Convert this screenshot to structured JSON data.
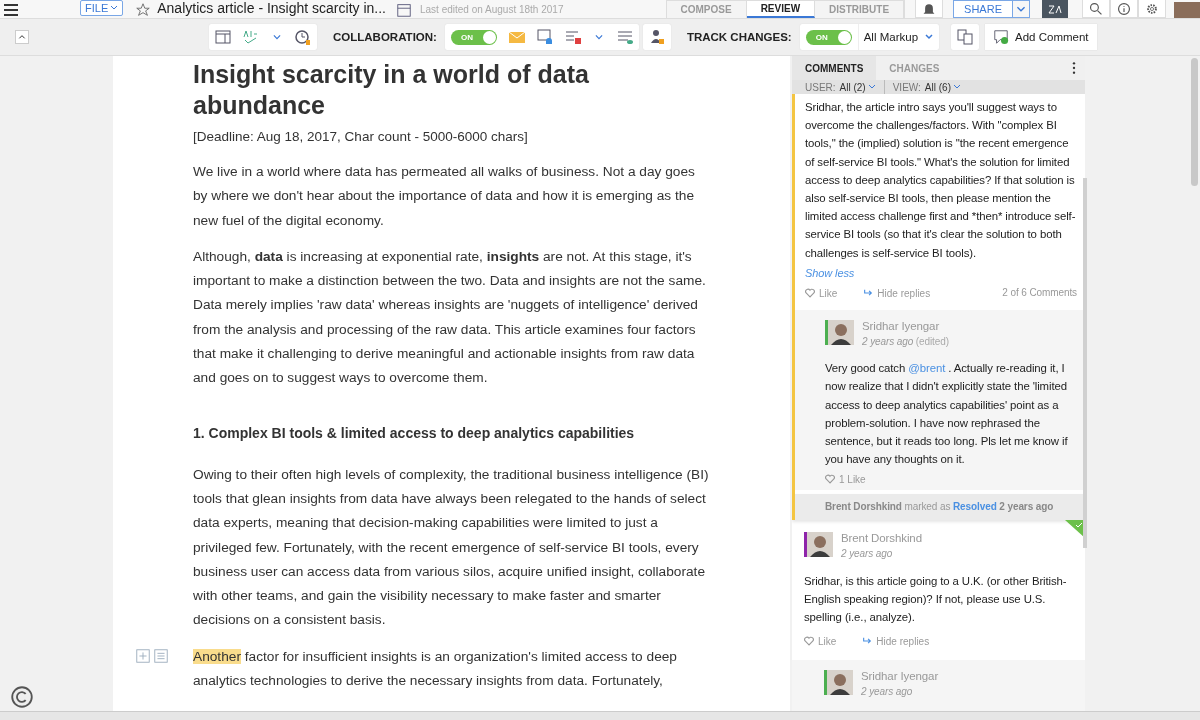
{
  "topbar": {
    "file_label": "FILE",
    "title": "Analytics article - Insight scarcity in...",
    "last_edited": "Last edited on August 18th 2017",
    "modes": [
      {
        "label": "COMPOSE",
        "selected": false
      },
      {
        "label": "REVIEW",
        "selected": true
      },
      {
        "label": "DISTRIBUTE",
        "selected": false
      }
    ],
    "share_label": "SHARE"
  },
  "toolbar": {
    "collaboration_label": "COLLABORATION:",
    "collaboration": {
      "label": "ON",
      "on": true
    },
    "track_label": "TRACK CHANGES:",
    "track": {
      "label": "ON",
      "on": true
    },
    "markup": "All Markup",
    "add_comment": "Add Comment"
  },
  "document": {
    "title": "Insight scarcity in a world of data abundance",
    "subtitle": "[Deadline: Aug 18, 2017, Char count - 5000-6000 chars]",
    "blocks": [
      {
        "kind": "paragraph",
        "text": "We live in a world where data has permeated all walks of business. Not a day goes by where we don't hear about the importance of data and how it is emerging as the new fuel of the digital economy."
      },
      {
        "kind": "paragraph",
        "text": "Although, **data** is increasing at exponential rate, **insights** are not. At this stage, it's important to make a distinction between the two. Data and insights are not the same. Data merely implies 'raw data' whereas insights are 'nuggets of intelligence' derived from the analysis and processing of the raw data. This article examines four factors that make it challenging to derive meaningful and actionable insights from raw data and goes on to suggest ways to overcome them."
      },
      {
        "kind": "heading",
        "text": "1. Complex BI tools & limited access to deep analytics capabilities"
      },
      {
        "kind": "paragraph",
        "text": "Owing to their often high levels of complexity, the traditional business intelligence (BI) tools that glean insights from data have always been relegated to the hands of select data experts, meaning that decision-making capabilities were limited to just a privileged few. Fortunately, with the recent emergence of self-service BI tools, every business user can access data from various silos, acquire unified insight, collaborate with other teams, and gain the visibility necessary to make faster and smarter decisions on a consistent basis."
      },
      {
        "kind": "highlighted",
        "highlight": "Another",
        "text": " factor for insufficient insights is an organization's limited access to deep analytics technologies to derive the necessary insights from data. Fortunately,"
      }
    ]
  },
  "comments": {
    "tabs": [
      {
        "label": "COMMENTS",
        "selected": true
      },
      {
        "label": "CHANGES",
        "selected": false
      }
    ],
    "filters": [
      {
        "label": "USER:",
        "value": "All (2)"
      },
      {
        "label": "VIEW:",
        "value": "All (6)"
      }
    ],
    "thread": {
      "text": "Sridhar, the article intro says you'll suggest ways to overcome the challenges/factors. With \"complex BI tools,\" the (implied) solution is \"the recent emergence of self-service BI tools.\" What's the solution for limited access to deep analytics capabilities? If that solution is also self-service BI tools, then please mention the limited access challenge first and *then* introduce self-service BI tools (so that it's clear the solution to both challenges is self-service BI tools).",
      "show_less": "Show less",
      "like": "Like",
      "hide_replies": "Hide replies",
      "count": "2 of 6 Comments",
      "reply": {
        "author": "Sridhar Iyengar",
        "color": "#4caf50",
        "time": "2 years ago",
        "edited": "(edited)",
        "before": "Very good catch ",
        "mention": "@brent",
        "after": " . Actually re-reading it, I now realize that I didn't explicitly state the 'limited access to deep analytics capabilities' point as a problem-solution. I have now rephrased the sentence, but it reads too long. Pls let me know if you have any thoughts on it.",
        "likes": "1 Like"
      },
      "resolved": {
        "actor": "Brent Dorshkind",
        "action": " marked as ",
        "status": "Resolved",
        "time": " 2 years ago"
      }
    },
    "thread2": {
      "resolved": true,
      "author": "Brent Dorshkind",
      "color": "#8e24aa",
      "time": "2 years ago",
      "text": "Sridhar, is this article going to a U.K. (or other British-English speaking region)? If not, please use U.S. spelling (i.e., analyze).",
      "like": "Like",
      "hide_replies": "Hide replies",
      "reply": {
        "author": "Sridhar Iyengar",
        "color": "#4caf50",
        "time": "2 years ago"
      }
    }
  }
}
